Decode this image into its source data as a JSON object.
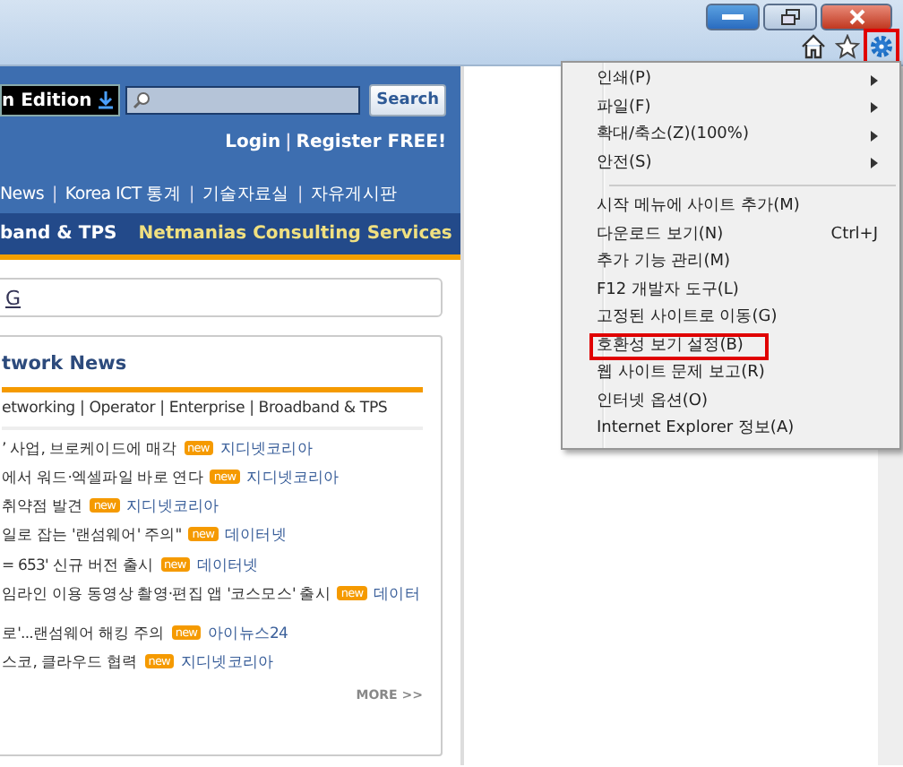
{
  "browser": {
    "tools_highlighted": true
  },
  "header": {
    "edition": "n Edition",
    "search_button": "Search",
    "login_line": [
      {
        "label": "Login",
        "kind": "link"
      },
      {
        "label": "|",
        "kind": "separator"
      },
      {
        "label": "Register FREE!",
        "kind": "link"
      }
    ],
    "nav": [
      {
        "label": "News",
        "kind": "link"
      },
      {
        "label": "|",
        "kind": "separator"
      },
      {
        "label": "Korea ICT 통계",
        "kind": "link"
      },
      {
        "label": "|",
        "kind": "separator"
      },
      {
        "label": "기술자료실",
        "kind": "link"
      },
      {
        "label": "|",
        "kind": "separator"
      },
      {
        "label": "자유게시판",
        "kind": "link"
      }
    ],
    "subnav": [
      {
        "label": "band & TPS",
        "kind": "plain"
      },
      {
        "label": "Netmanias Consulting Services",
        "kind": "accent"
      }
    ]
  },
  "search_box": {
    "value": "G"
  },
  "news": {
    "title": "twork News",
    "categories": "etworking | Operator | Enterprise | Broadband & TPS",
    "items": [
      {
        "title": "’ 사업, 브로케이드에 매각",
        "badge": "new",
        "source": "지디넷코리아"
      },
      {
        "title": "에서 워드·엑셀파일 바로 연다",
        "badge": "new",
        "source": "지디넷코리아"
      },
      {
        "title": "취약점 발견",
        "badge": "new",
        "source": "지디넷코리아"
      },
      {
        "title": "일로 잡는 '랜섬웨어' 주의\"",
        "badge": "new",
        "source": "데이터넷"
      },
      {
        "title": "= 653' 신규 버전 출시",
        "badge": "new",
        "source": "데이터넷"
      },
      {
        "title": "임라인 이용 동영상 촬영·편집 앱 '코스모스' 출시",
        "badge": "new",
        "source": "데이터"
      },
      {
        "title": "로'...랜섬웨어 해킹 주의",
        "badge": "new",
        "source": "아이뉴스24"
      },
      {
        "title": "스코, 클라우드 협력",
        "badge": "new",
        "source": "지디넷코리아"
      }
    ],
    "more": "MORE >>"
  },
  "menu": [
    {
      "label": "인쇄(P)",
      "submenu": true,
      "highlighted": false,
      "separator_before": false
    },
    {
      "label": "파일(F)",
      "submenu": true,
      "highlighted": false,
      "separator_before": false
    },
    {
      "label": "확대/축소(Z)(100%)",
      "submenu": true,
      "highlighted": false,
      "separator_before": false
    },
    {
      "label": "안전(S)",
      "submenu": true,
      "highlighted": false,
      "separator_before": false
    },
    {
      "label": "시작 메뉴에 사이트 추가(M)",
      "submenu": false,
      "highlighted": false,
      "separator_before": true
    },
    {
      "label": "다운로드 보기(N)",
      "shortcut": "Ctrl+J",
      "submenu": false,
      "highlighted": false,
      "separator_before": false
    },
    {
      "label": "추가 기능 관리(M)",
      "submenu": false,
      "highlighted": false,
      "separator_before": false
    },
    {
      "label": "F12 개발자 도구(L)",
      "submenu": false,
      "highlighted": false,
      "separator_before": false
    },
    {
      "label": "고정된 사이트로 이동(G)",
      "submenu": false,
      "highlighted": false,
      "separator_before": false
    },
    {
      "label": "호환성 보기 설정(B)",
      "submenu": false,
      "highlighted": true,
      "separator_before": false
    },
    {
      "label": "웹 사이트 문제 보고(R)",
      "submenu": false,
      "highlighted": false,
      "separator_before": false
    },
    {
      "label": "인터넷 옵션(O)",
      "submenu": false,
      "highlighted": false,
      "separator_before": false
    },
    {
      "label": "Internet Explorer 정보(A)",
      "submenu": false,
      "highlighted": false,
      "separator_before": false
    }
  ]
}
